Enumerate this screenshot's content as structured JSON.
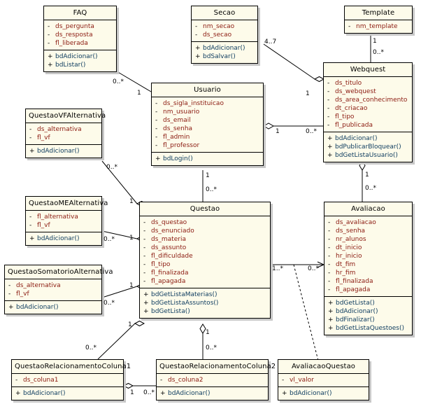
{
  "diagram": {
    "type": "uml-class-diagram",
    "background": "#ffffff",
    "class_fill": "#fdfbea",
    "attribute_color": "#8b1a10",
    "operation_color": "#0b3a5e",
    "border_color": "#000000"
  },
  "classes": {
    "faq": {
      "name": "FAQ",
      "attributes": [
        {
          "vis": "-",
          "text": "ds_pergunta"
        },
        {
          "vis": "-",
          "text": "ds_resposta"
        },
        {
          "vis": "-",
          "text": "fl_liberada"
        }
      ],
      "operations": [
        {
          "vis": "+",
          "text": "bdAdicionar()"
        },
        {
          "vis": "+",
          "text": "bdListar()"
        }
      ]
    },
    "secao": {
      "name": "Secao",
      "attributes": [
        {
          "vis": "-",
          "text": "nm_secao"
        },
        {
          "vis": "-",
          "text": "ds_secao"
        }
      ],
      "operations": [
        {
          "vis": "+",
          "text": "bdAdicionar()"
        },
        {
          "vis": "+",
          "text": "bdSalvar()"
        }
      ]
    },
    "template": {
      "name": "Template",
      "attributes": [
        {
          "vis": "-",
          "text": "nm_template"
        }
      ],
      "operations": []
    },
    "webquest": {
      "name": "Webquest",
      "attributes": [
        {
          "vis": "-",
          "text": "ds_titulo"
        },
        {
          "vis": "-",
          "text": "ds_webquest"
        },
        {
          "vis": "-",
          "text": "ds_area_conhecimento"
        },
        {
          "vis": "-",
          "text": "dt_criacao"
        },
        {
          "vis": "-",
          "text": "fl_tipo"
        },
        {
          "vis": "-",
          "text": "fl_publicada"
        }
      ],
      "operations": [
        {
          "vis": "+",
          "text": "bdAdicionar()"
        },
        {
          "vis": "+",
          "text": "bdPublicarBloquear()"
        },
        {
          "vis": "+",
          "text": "bdGetListaUsuario()"
        }
      ]
    },
    "usuario": {
      "name": "Usuario",
      "attributes": [
        {
          "vis": "-",
          "text": "ds_sigla_instituicao"
        },
        {
          "vis": "-",
          "text": "nm_usuario"
        },
        {
          "vis": "-",
          "text": "ds_email"
        },
        {
          "vis": "-",
          "text": "ds_senha"
        },
        {
          "vis": "-",
          "text": "fl_admin"
        },
        {
          "vis": "-",
          "text": "fl_professor"
        }
      ],
      "operations": [
        {
          "vis": "+",
          "text": "bdLogin()"
        }
      ]
    },
    "questao_vf_alternativa": {
      "name": "QuestaoVFAlternativa",
      "attributes": [
        {
          "vis": "-",
          "text": "ds_alternativa"
        },
        {
          "vis": "-",
          "text": "fl_vf"
        }
      ],
      "operations": [
        {
          "vis": "+",
          "text": "bdAdicionar()"
        }
      ]
    },
    "questao_me_alternativa": {
      "name": "QuestaoMEAlternativa",
      "attributes": [
        {
          "vis": "-",
          "text": "fl_alternativa"
        },
        {
          "vis": "-",
          "text": "fl_vf"
        }
      ],
      "operations": [
        {
          "vis": "+",
          "text": "bdAdicionar()"
        }
      ]
    },
    "questao_somatorio_alternativa": {
      "name": "QuestaoSomatorioAlternativa",
      "attributes": [
        {
          "vis": "-",
          "text": "ds_alternativa"
        },
        {
          "vis": "-",
          "text": "fl_vf"
        }
      ],
      "operations": [
        {
          "vis": "+",
          "text": "bdAdicionar()"
        }
      ]
    },
    "questao": {
      "name": "Questao",
      "attributes": [
        {
          "vis": "-",
          "text": "ds_questao"
        },
        {
          "vis": "-",
          "text": "ds_enunciado"
        },
        {
          "vis": "-",
          "text": "ds_materia"
        },
        {
          "vis": "-",
          "text": "ds_assunto"
        },
        {
          "vis": "-",
          "text": "fl_dificuldade"
        },
        {
          "vis": "-",
          "text": "fl_tipo"
        },
        {
          "vis": "-",
          "text": "fl_finalizada"
        },
        {
          "vis": "-",
          "text": "fl_apagada"
        }
      ],
      "operations": [
        {
          "vis": "+",
          "text": "bdGetListaMaterias()"
        },
        {
          "vis": "+",
          "text": "bdGetListaAssuntos()"
        },
        {
          "vis": "+",
          "text": "bdGetLista()"
        }
      ]
    },
    "avaliacao": {
      "name": "Avaliacao",
      "attributes": [
        {
          "vis": "-",
          "text": "ds_avaliacao"
        },
        {
          "vis": "-",
          "text": "ds_senha"
        },
        {
          "vis": "-",
          "text": "nr_alunos"
        },
        {
          "vis": "-",
          "text": "dt_inicio"
        },
        {
          "vis": "-",
          "text": "hr_inicio"
        },
        {
          "vis": "-",
          "text": "dt_fim"
        },
        {
          "vis": "-",
          "text": "hr_fim"
        },
        {
          "vis": "-",
          "text": "fl_finalizada"
        },
        {
          "vis": "-",
          "text": "fl_apagada"
        }
      ],
      "operations": [
        {
          "vis": "+",
          "text": "bdGetLista()"
        },
        {
          "vis": "+",
          "text": "bdAdicionar()"
        },
        {
          "vis": "+",
          "text": "bdFinalizar()"
        },
        {
          "vis": "+",
          "text": "bdGetListaQuestoes()"
        }
      ]
    },
    "questao_relacionamento_coluna1": {
      "name": "QuestaoRelacionamentoColuna1",
      "attributes": [
        {
          "vis": "-",
          "text": "ds_coluna1"
        }
      ],
      "operations": [
        {
          "vis": "+",
          "text": "bdAdicionar()"
        }
      ]
    },
    "questao_relacionamento_coluna2": {
      "name": "QuestaoRelacionamentoColuna2",
      "attributes": [
        {
          "vis": "-",
          "text": "ds_coluna2"
        }
      ],
      "operations": [
        {
          "vis": "+",
          "text": "bdAdicionar()"
        }
      ]
    },
    "avaliacao_questao": {
      "name": "AvaliacaoQuestao",
      "attributes": [
        {
          "vis": "-",
          "text": "vl_valor"
        }
      ],
      "operations": [
        {
          "vis": "+",
          "text": "bdAdicionar()"
        }
      ]
    }
  },
  "multiplicities": {
    "faq_usuario_faq_end": "0..*",
    "faq_usuario_usuario_end": "1",
    "secao_webquest_secao_end": "4..7",
    "secao_webquest_webquest_end": "1",
    "template_webquest_template_end": "1",
    "template_webquest_webquest_end": "0..*",
    "usuario_webquest_usuario_end": "1",
    "usuario_webquest_webquest_end": "0..*",
    "usuario_questao_usuario_end": "1",
    "usuario_questao_questao_end": "0..*",
    "webquest_avaliacao_webquest_end": "1",
    "webquest_avaliacao_avaliacao_end": "0..*",
    "questao_avaliacao_questao_end": "1..*",
    "questao_avaliacao_avaliacao_end": "0..*",
    "vf_questao_vf_end": "0..*",
    "vf_questao_questao_end": "1",
    "me_questao_me_end": "0..*",
    "me_questao_questao_end": "1",
    "som_questao_som_end": "0..*",
    "som_questao_questao_end": "1",
    "coluna1_questao_coluna1_end": "0..*",
    "coluna1_questao_questao_end": "1",
    "questao_coluna2_questao_end": "1",
    "questao_coluna2_coluna2_end": "0..*",
    "coluna1_coluna2_coluna1_end": "1",
    "coluna1_coluna2_coluna2_end": "0..*"
  }
}
